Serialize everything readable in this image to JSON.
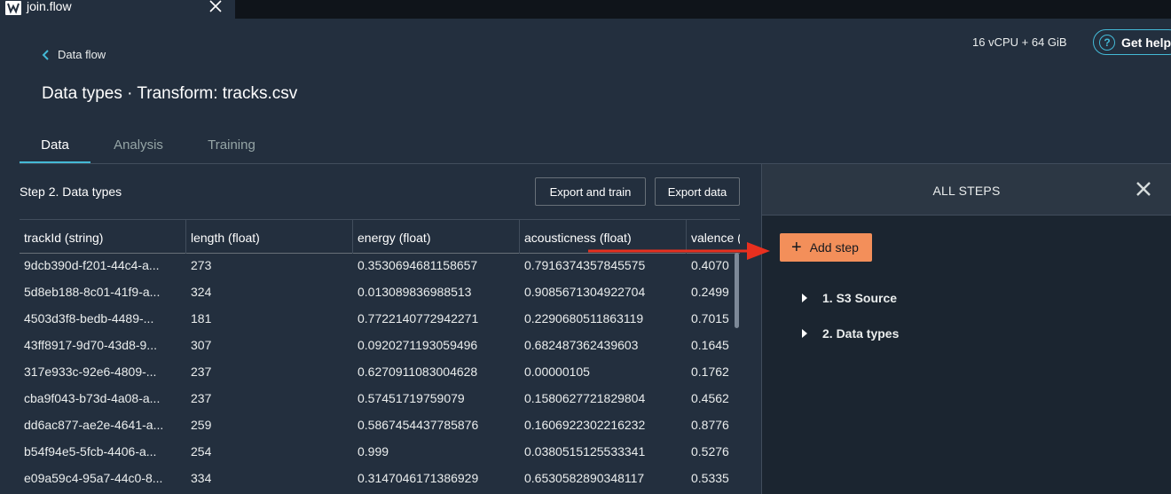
{
  "window": {
    "file_tab": "join.flow"
  },
  "header": {
    "resources": "16 vCPU + 64 GiB",
    "help_label": "Get help"
  },
  "breadcrumb": {
    "label": "Data flow"
  },
  "page_title": "Data types · Transform: tracks.csv",
  "tabs": [
    {
      "label": "Data",
      "active": true
    },
    {
      "label": "Analysis",
      "active": false
    },
    {
      "label": "Training",
      "active": false
    }
  ],
  "data_panel": {
    "step_label": "Step 2. Data types",
    "export_train_label": "Export and train",
    "export_data_label": "Export data",
    "columns": [
      "trackId (string)",
      "length (float)",
      "energy (float)",
      "acousticness (float)",
      "valence ("
    ],
    "rows": [
      [
        "9dcb390d-f201-44c4-a...",
        "273",
        "0.3530694681158657",
        "0.7916374357845575",
        "0.4070"
      ],
      [
        "5d8eb188-8c01-41f9-a...",
        "324",
        "0.013089836988513",
        "0.9085671304922704",
        "0.2499"
      ],
      [
        "4503d3f8-bedb-4489-...",
        "181",
        "0.7722140772942271",
        "0.2290680511863119",
        "0.7015"
      ],
      [
        "43ff8917-9d70-43d8-9...",
        "307",
        "0.0920271193059496",
        "0.682487362439603",
        "0.1645"
      ],
      [
        "317e933c-92e6-4809-...",
        "237",
        "0.6270911083004628",
        "0.00000105",
        "0.1762"
      ],
      [
        "cba9f043-b73d-4a08-a...",
        "237",
        "0.57451719759079",
        "0.1580627721829804",
        "0.4562"
      ],
      [
        "dd6ac877-ae2e-4641-a...",
        "259",
        "0.5867454437785876",
        "0.1606922302216232",
        "0.8776"
      ],
      [
        "b54f94e5-5fcb-4406-a...",
        "254",
        "0.999",
        "0.0380515125533341",
        "0.5276"
      ],
      [
        "e09a59c4-95a7-44c0-8...",
        "334",
        "0.3147046171386929",
        "0.6530582890348117",
        "0.5335"
      ]
    ]
  },
  "steps_panel": {
    "title": "ALL STEPS",
    "add_step_label": "Add step",
    "steps": [
      "1. S3 Source",
      "2. Data types"
    ]
  },
  "colors": {
    "accent": "#44b9d6",
    "add_step": "#f38f5a",
    "arrow": "#e8301f"
  }
}
